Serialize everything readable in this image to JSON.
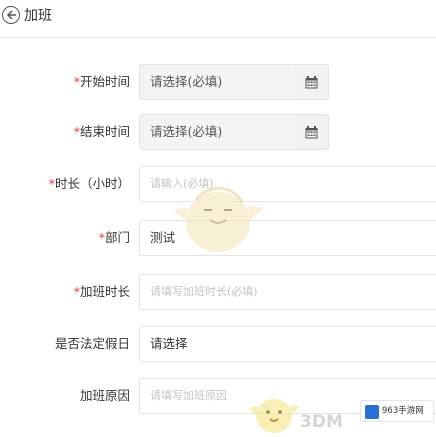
{
  "header": {
    "title": "加班",
    "back_icon": "back-arrow-icon"
  },
  "form": {
    "start_time": {
      "required_mark": "*",
      "label": "开始时间",
      "value": "请选择(必填)",
      "button_icon": "calendar-icon"
    },
    "end_time": {
      "required_mark": "*",
      "label": "结束时间",
      "value": "请选择(必填)",
      "button_icon": "calendar-icon"
    },
    "duration": {
      "required_mark": "*",
      "label": "时长（小时）",
      "placeholder": "请输入(必填)"
    },
    "department": {
      "required_mark": "*",
      "label": "部门",
      "value": "测试"
    },
    "overtime_duration": {
      "required_mark": "*",
      "label": "加班时长",
      "placeholder": "请填写加班时长(必填)"
    },
    "legal_holiday": {
      "label": "是否法定假日",
      "value": "请选择"
    },
    "overtime_reason": {
      "label": "加班原因",
      "placeholder": "请填写加班原因"
    }
  },
  "watermarks": {
    "site_mark": "3DM",
    "site_logo_text": "963手游网"
  },
  "colors": {
    "required": "#e4393c",
    "disabled_bg": "#f4f4f4",
    "border": "#e3e3e3"
  }
}
